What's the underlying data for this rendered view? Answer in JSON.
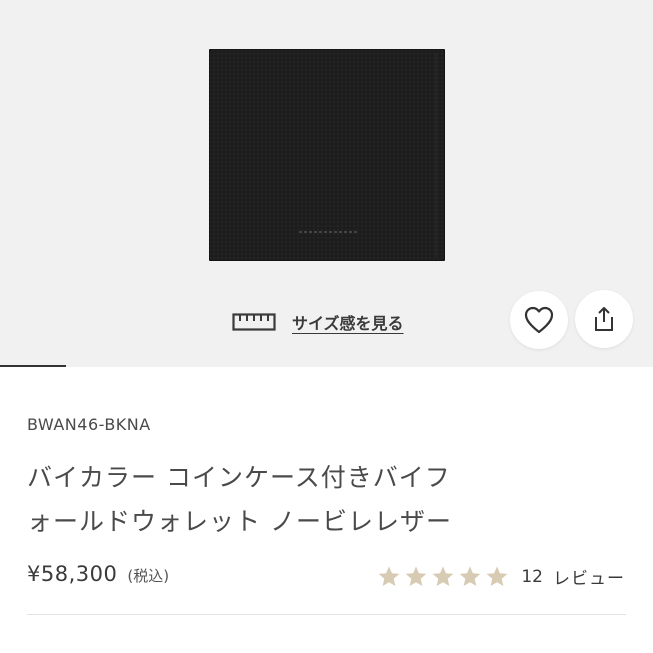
{
  "product": {
    "size_link_label": "サイズ感を見る",
    "sku": "BWAN46-BKNA",
    "title_lines": [
      "バイカラー コインケース付きバイフ",
      "ォールドウォレット ノービレレザー"
    ],
    "price": "¥58,300",
    "tax_note": "(税込)",
    "rating": {
      "stars": 5,
      "max_stars": 5,
      "review_count": "12",
      "review_label": "レビュー"
    }
  },
  "icons": {
    "size": "ruler-icon",
    "favorite": "heart-icon",
    "share": "share-icon",
    "star": "star-icon"
  },
  "colors": {
    "hero_background": "#f1f1f1",
    "star": "#d8cbb3",
    "text": "#3a3a3a",
    "divider": "#e2e2e2"
  }
}
